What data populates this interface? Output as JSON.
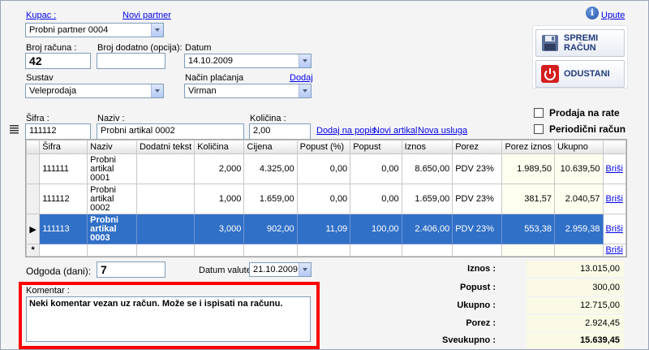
{
  "header": {
    "kupac_label": "Kupac :",
    "novi_partner": "Novi partner",
    "upute": "Upute",
    "kupac_value": "Probni partner 0004"
  },
  "form": {
    "broj_racuna_label": "Broj računa :",
    "broj_racuna_value": "42",
    "broj_dodatno_label": "Broj dodatno (opcija):",
    "broj_dodatno_value": "",
    "datum_label": "Datum",
    "datum_value": "14.10.2009",
    "sustav_label": "Sustav",
    "sustav_value": "Veleprodaja",
    "nacin_placanja_label": "Način plaćanja",
    "dodaj_link": "Dodaj",
    "nacin_placanja_value": "Virman"
  },
  "actions": {
    "spremi": "SPREMI RAČUN",
    "odustani": "ODUSTANI",
    "prodaja_na_rate": "Prodaja na rate",
    "periodicni_racun": "Periodični račun"
  },
  "entry": {
    "sifra_label": "Šifra :",
    "sifra_value": "111112",
    "naziv_label": "Naziv :",
    "naziv_value": "Probni artikal 0002",
    "kolicina_label": "Količina :",
    "kolicina_value": "2,00",
    "dodaj_na_popis": "Dodaj na popis",
    "novi_artikal": "Novi artikal",
    "nova_usluga": "Nova usluga"
  },
  "grid": {
    "columns": [
      "Šifra",
      "Naziv",
      "Dodatni tekst",
      "Količina",
      "Cijena",
      "Popust (%)",
      "Popust",
      "Iznos",
      "Porez",
      "Porez iznos",
      "Ukupno",
      ""
    ],
    "rows": [
      {
        "sifra": "111111",
        "naziv": "Probni artikal 0001",
        "dodatni": "",
        "kolicina": "2,000",
        "cijena": "4.325,00",
        "popust_pct": "0,00",
        "popust": "0,00",
        "iznos": "8.650,00",
        "porez": "PDV 23%",
        "porez_iznos": "1.989,50",
        "ukupno": "10.639,50",
        "akcija": "Briši"
      },
      {
        "sifra": "111112",
        "naziv": "Probni artikal 0002",
        "dodatni": "",
        "kolicina": "1,000",
        "cijena": "1.659,00",
        "popust_pct": "0,00",
        "popust": "0,00",
        "iznos": "1.659,00",
        "porez": "PDV 23%",
        "porez_iznos": "381,57",
        "ukupno": "2.040,57",
        "akcija": "Briši"
      },
      {
        "sifra": "111113",
        "naziv": "Probni artikal 0003",
        "dodatni": "",
        "kolicina": "3,000",
        "cijena": "902,00",
        "popust_pct": "11,09",
        "popust": "100,00",
        "iznos": "2.406,00",
        "porez": "PDV 23%",
        "porez_iznos": "553,38",
        "ukupno": "2.959,38",
        "akcija": "Briši"
      }
    ],
    "new_row_action": "Briši",
    "new_row_marker": "*",
    "current_row_marker": "▶"
  },
  "footer": {
    "odgoda_label": "Odgoda (dani):",
    "odgoda_value": "7",
    "datum_valute_label": "Datum valute",
    "datum_valute_value": "21.10.2009",
    "komentar_label": "Komentar :",
    "komentar_value": "Neki komentar vezan uz račun. Može se i ispisati na računu."
  },
  "totals": {
    "iznos_label": "Iznos :",
    "iznos_value": "13.015,00",
    "popust_label": "Popust :",
    "popust_value": "300,00",
    "ukupno_label": "Ukupno :",
    "ukupno_value": "12.715,00",
    "porez_label": "Porez :",
    "porez_value": "2.924,45",
    "sveukupno_label": "Sveukupno :",
    "sveukupno_value": "15.639,45"
  },
  "colors": {
    "selection": "#3170c7",
    "highlight_border": "#ff0000",
    "link": "#0000ee",
    "totals_bg": "#fafae6"
  }
}
